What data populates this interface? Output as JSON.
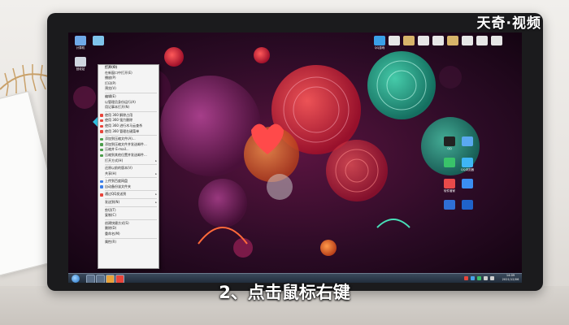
{
  "watermark": {
    "logo_text": "天奇·视频"
  },
  "subtitle": "2、点击鼠标右键",
  "desktop": {
    "left_icons": [
      {
        "label": "计算机",
        "icon": "computer-icon",
        "color": "#6fa9e8"
      },
      {
        "label": "回收站",
        "icon": "recycle-bin-icon",
        "color": "#cfd6df"
      },
      {
        "label": "",
        "icon": "app-icon",
        "color": "#7ec3ea"
      }
    ],
    "top_icons": [
      {
        "label": "QQ游戏",
        "icon": "qq-games-icon",
        "color": "#3aa0e8"
      },
      {
        "label": "",
        "icon": "app-icon",
        "color": "#e6e6e6"
      },
      {
        "label": "",
        "icon": "app-icon",
        "color": "#d7b46a"
      },
      {
        "label": "",
        "icon": "app-icon",
        "color": "#e6e6e6"
      },
      {
        "label": "",
        "icon": "app-icon",
        "color": "#e6e6e6"
      },
      {
        "label": "",
        "icon": "app-icon",
        "color": "#d7b46a"
      },
      {
        "label": "",
        "icon": "app-icon",
        "color": "#e6e6e6"
      },
      {
        "label": "",
        "icon": "app-icon",
        "color": "#e6e6e6"
      },
      {
        "label": "",
        "icon": "app-icon",
        "color": "#e6e6e6"
      }
    ],
    "right_icons": [
      {
        "label": "QQ",
        "icon": "qq-icon",
        "color": "#222"
      },
      {
        "label": "",
        "icon": "app-icon",
        "color": "#5aa9f0"
      },
      {
        "label": "",
        "icon": "app-icon",
        "color": "#39c36a"
      },
      {
        "label": "QQ浏览器",
        "icon": "browser-icon",
        "color": "#3fb6f5"
      },
      {
        "label": "软件管家",
        "icon": "software-manager-icon",
        "color": "#e84a4a"
      },
      {
        "label": "",
        "icon": "app-icon",
        "color": "#3b8ef0"
      },
      {
        "label": "",
        "icon": "app-icon",
        "color": "#2f6fd6"
      },
      {
        "label": "",
        "icon": "app-icon",
        "color": "#1f63c9"
      }
    ]
  },
  "context_menu": {
    "items": [
      {
        "label": "打开(O)",
        "type": "item",
        "bold": true,
        "icon": ""
      },
      {
        "label": "在新窗口中打开(E)",
        "type": "item",
        "icon": ""
      },
      {
        "label": "播放(P)",
        "type": "item",
        "icon": ""
      },
      {
        "label": "打印(P)",
        "type": "item",
        "icon": ""
      },
      {
        "label": "预览(V)",
        "type": "item",
        "icon": ""
      },
      {
        "type": "sep"
      },
      {
        "label": "编辑(E)",
        "type": "item",
        "icon": ""
      },
      {
        "label": "以管理员身份运行(A)",
        "type": "item",
        "icon": ""
      },
      {
        "label": "用记事本打开(N)",
        "type": "item",
        "icon": ""
      },
      {
        "type": "sep"
      },
      {
        "label": "使用 360 解除占用",
        "type": "item",
        "icon": "#e8443a"
      },
      {
        "label": "使用 360 强力删除",
        "type": "item",
        "icon": "#e8443a"
      },
      {
        "label": "使用 360 进行木马云查杀",
        "type": "item",
        "icon": "#e8443a"
      },
      {
        "label": "使用 360 管理右键菜单",
        "type": "item",
        "icon": "#e8443a"
      },
      {
        "type": "sep"
      },
      {
        "label": "添加到压缩文件(A)...",
        "type": "item",
        "icon": "#4a9c4a"
      },
      {
        "label": "添加到压缩文件并发送邮件...",
        "type": "item",
        "icon": "#4a9c4a"
      },
      {
        "label": "压缩并 E-mail...",
        "type": "item",
        "icon": "#4a9c4a"
      },
      {
        "label": "压缩到其他位置并发送邮件...",
        "type": "item",
        "icon": "#4a9c4a"
      },
      {
        "label": "打开方式(H)",
        "type": "item",
        "icon": "",
        "submenu": true
      },
      {
        "type": "sep"
      },
      {
        "label": "还原以前的版本(V)",
        "type": "item",
        "icon": ""
      },
      {
        "label": "共享(H)",
        "type": "item",
        "icon": "",
        "submenu": true
      },
      {
        "type": "sep"
      },
      {
        "label": "上传到百度网盘",
        "type": "item",
        "icon": "#3a7de8"
      },
      {
        "label": "自动备份该文件夹",
        "type": "item",
        "icon": "#3a7de8"
      },
      {
        "type": "sep"
      },
      {
        "label": "通过QQ发送到",
        "type": "item",
        "icon": "#e8443a",
        "submenu": true
      },
      {
        "type": "sep"
      },
      {
        "label": "发送到(N)",
        "type": "item",
        "icon": "",
        "submenu": true
      },
      {
        "type": "sep"
      },
      {
        "label": "剪切(T)",
        "type": "item",
        "icon": ""
      },
      {
        "label": "复制(C)",
        "type": "item",
        "icon": ""
      },
      {
        "type": "sep"
      },
      {
        "label": "创建快捷方式(S)",
        "type": "item",
        "icon": ""
      },
      {
        "label": "删除(D)",
        "type": "item",
        "icon": ""
      },
      {
        "label": "重命名(M)",
        "type": "item",
        "icon": ""
      },
      {
        "type": "sep"
      },
      {
        "label": "属性(R)",
        "type": "item",
        "icon": ""
      }
    ]
  },
  "taskbar": {
    "clock_time": "14:09",
    "clock_date": "2021/12/06"
  },
  "colors": {
    "wallpaper_base": "#2a0a22",
    "accent_red": "#e8443a",
    "accent_teal": "#2fbf9f"
  }
}
